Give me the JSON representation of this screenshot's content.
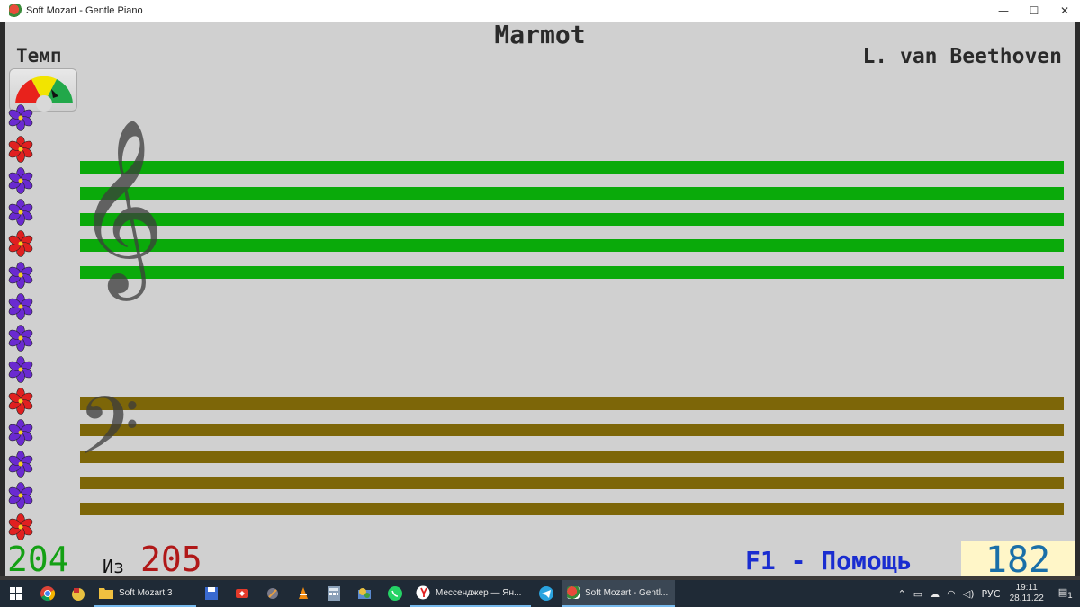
{
  "window": {
    "title": "Soft Mozart - Gentle Piano",
    "minimize_glyph": "—",
    "maximize_glyph": "☐",
    "close_glyph": "✕"
  },
  "piece": {
    "title": "Marmot",
    "composer": "L. van Beethoven"
  },
  "tempo": {
    "label": "Темп",
    "gauge_colors": [
      "#e8221c",
      "#f2e400",
      "#22a84a"
    ]
  },
  "flowers": [
    "purple",
    "red",
    "purple",
    "purple",
    "red",
    "purple",
    "purple",
    "purple",
    "purple",
    "red",
    "purple",
    "purple",
    "purple",
    "red"
  ],
  "colors": {
    "treble_staff": "#0aaa0a",
    "bass_staff": "#7d6608",
    "flower_purple": "#6a2ad0",
    "flower_red": "#e02020"
  },
  "staves": {
    "treble_clef": "𝄞",
    "bass_clef": "𝄢"
  },
  "progress": {
    "current": "204",
    "of_label": "Из",
    "total": "205"
  },
  "help_hint": "F1 - Помощь",
  "score": "182",
  "taskbar": {
    "items": [
      {
        "name": "soft-mozart-3-folder",
        "label": "Soft Mozart 3"
      },
      {
        "name": "yandex-messenger",
        "label": "Мессенджер — Ян..."
      },
      {
        "name": "soft-mozart-window",
        "label": "Soft Mozart - Gentl..."
      }
    ],
    "language": "РУС",
    "time": "19:11",
    "date": "28.11.22",
    "notification_count": "1"
  }
}
